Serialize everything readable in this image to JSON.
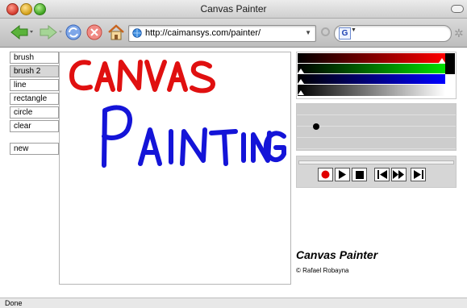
{
  "window": {
    "title": "Canvas Painter"
  },
  "toolbar": {
    "address_url": "http://caimansys.com/painter/",
    "search_badge": "G"
  },
  "tools": [
    {
      "label": "brush",
      "selected": false
    },
    {
      "label": "brush 2",
      "selected": true
    },
    {
      "label": "line",
      "selected": false
    },
    {
      "label": "rectangle",
      "selected": false
    },
    {
      "label": "circle",
      "selected": false
    },
    {
      "label": "clear",
      "selected": false
    },
    {
      "label": "new",
      "selected": false
    }
  ],
  "canvas_drawing": {
    "line1": {
      "text": "CANVAS",
      "color": "#e01010"
    },
    "line2": {
      "text": "PAINTING",
      "color": "#1414d8"
    }
  },
  "color_picker": {
    "red": 1.0,
    "green": 0.0,
    "blue": 0.0,
    "gray": 0.0,
    "current_color": "#000000"
  },
  "brush": {
    "size_level": 0.1
  },
  "playback": {
    "buttons": [
      "record",
      "play",
      "stop",
      "skip-to-start",
      "fast-forward",
      "skip-to-end"
    ]
  },
  "info": {
    "app_title": "Canvas Painter",
    "copyright": "© Rafael Robayna"
  },
  "status": {
    "text": "Done"
  }
}
